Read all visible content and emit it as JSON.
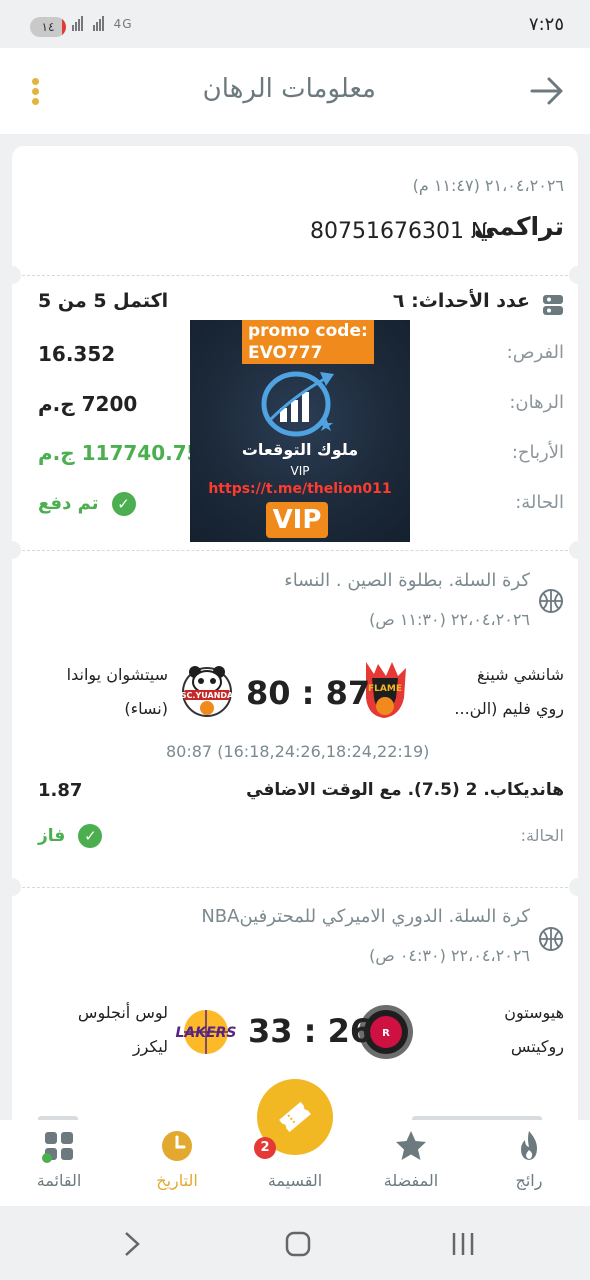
{
  "status_bar": {
    "time": "٧:٢٥",
    "battery": "١٤",
    "network": "4G"
  },
  "header": {
    "title": "معلومات الرهان"
  },
  "bet": {
    "date": "٢١،٠٤،٢٠٢٦ (١١:٤٧ م)",
    "type": "تراكمي",
    "number": "80751676301 №",
    "events_label": "عدد الأحداث: ٦",
    "completed": "اكتمل 5 من 5",
    "odds_label": "الفرص:",
    "odds_value": "16.352",
    "stake_label": "الرهان:",
    "stake_value": "7200 ج.م",
    "winnings_label": "الأرباح:",
    "winnings_value": "117740.75 ج.م",
    "status_label": "الحالة:",
    "status_value": "تم دفع"
  },
  "promo": {
    "code_line1": "promo code:",
    "code_line2": "EVO777",
    "arabic": "ملوك التوقعات",
    "vip_small": "VIP",
    "link": "https://t.me/thelion011",
    "vip": "VIP"
  },
  "events": [
    {
      "league": "كرة السلة. بطلوة الصين . النساء",
      "date": "٢٢،٠٤،٢٠٢٦ (١١:٣٠ ص)",
      "home_line1": "شانشي شينغ",
      "home_line2": "روي فليم (الن...",
      "away_line1": "سيتشوان يواندا",
      "away_line2": "(نساء)",
      "score": "80 : 87",
      "sets": "80:87 (16:18,24:26,18:24,22:19)",
      "market": "هانديكاب. 2 (7.5). مع الوقت الاضافي",
      "odd": "1.87",
      "status_label": "الحالة:",
      "status_value": "فاز"
    },
    {
      "league": "كرة السلة. الدوري الاميركي للمحترفينNBA",
      "date": "٢٢،٠٤،٢٠٢٦ (٠٤:٣٠ ص)",
      "home_line1": "هيوستون",
      "home_line2": "روكيتس",
      "away_line1": "لوس أنجلوس",
      "away_line2": "ليكرز",
      "score": "33 : 26"
    }
  ],
  "bottom_nav": [
    {
      "label": "رائج",
      "icon": "fire-icon"
    },
    {
      "label": "المفضلة",
      "icon": "star-icon"
    },
    {
      "label": "القسيمة",
      "icon": "ticket-icon",
      "badge": "2"
    },
    {
      "label": "التاريخ",
      "icon": "clock-icon"
    },
    {
      "label": "القائمة",
      "icon": "grid-icon"
    }
  ],
  "colors": {
    "accent": "#f2b824",
    "win": "#4bae4f",
    "badge": "#e53935"
  }
}
